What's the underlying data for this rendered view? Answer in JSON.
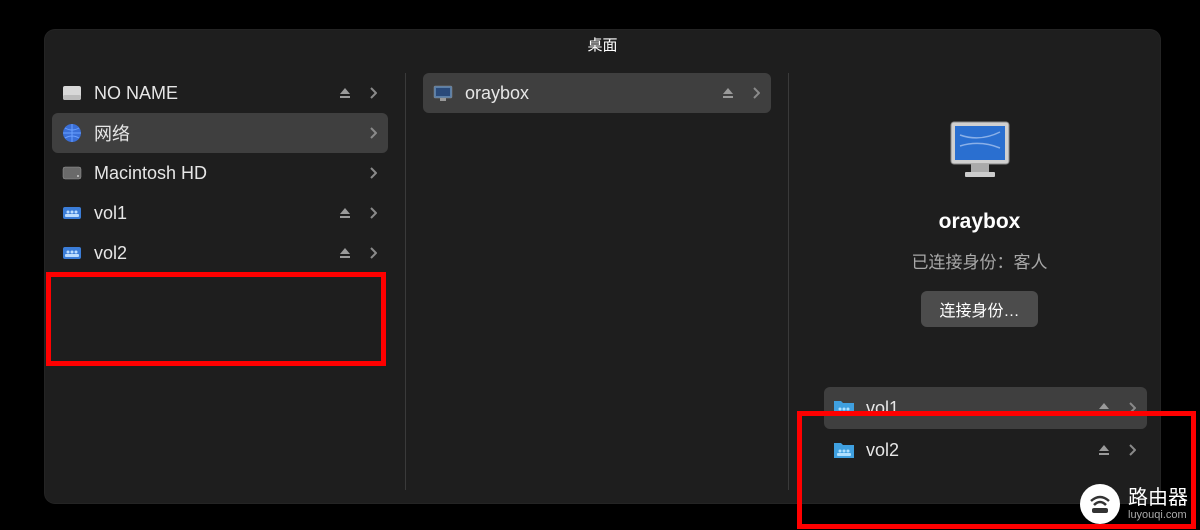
{
  "window": {
    "title": "桌面"
  },
  "col1": {
    "items": [
      {
        "label": "NO NAME",
        "icon": "drive",
        "eject": true,
        "chevron": true,
        "selected": false
      },
      {
        "label": "网络",
        "icon": "network",
        "eject": false,
        "chevron": true,
        "selected": true
      },
      {
        "label": "Macintosh HD",
        "icon": "hdd",
        "eject": false,
        "chevron": true,
        "selected": false
      },
      {
        "label": "vol1",
        "icon": "share",
        "eject": true,
        "chevron": true,
        "selected": false
      },
      {
        "label": "vol2",
        "icon": "share",
        "eject": true,
        "chevron": true,
        "selected": false
      }
    ]
  },
  "col2": {
    "items": [
      {
        "label": "oraybox",
        "icon": "computer",
        "eject": true,
        "chevron": true,
        "selected": true
      }
    ]
  },
  "col3": {
    "server_name": "oraybox",
    "status": "已连接身份：客人",
    "connect_label": "连接身份…",
    "items": [
      {
        "label": "vol1",
        "icon": "sharefolder",
        "eject": true,
        "chevron": true,
        "selected": true
      },
      {
        "label": "vol2",
        "icon": "sharefolder",
        "eject": true,
        "chevron": true,
        "selected": false
      }
    ]
  },
  "watermark": {
    "main": "路由器",
    "sub": "luyouqi.com"
  }
}
